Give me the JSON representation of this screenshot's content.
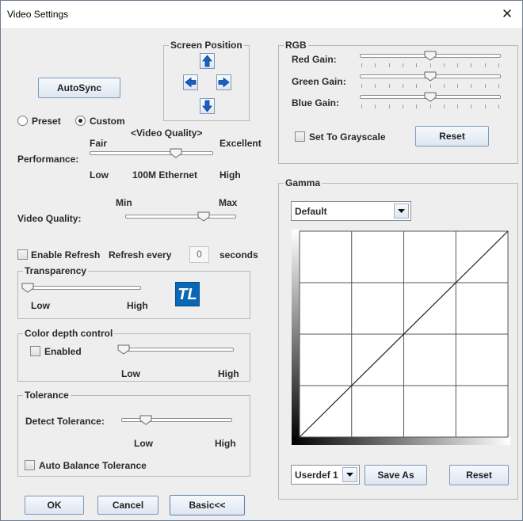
{
  "window": {
    "title": "Video Settings",
    "close_glyph": "✕"
  },
  "autosync_label": "AutoSync",
  "screen_position": {
    "legend": "Screen Position",
    "arrow_icons": [
      "arrow-up-icon",
      "arrow-left-icon",
      "arrow-right-icon",
      "arrow-down-icon"
    ]
  },
  "mode": {
    "preset_label": "Preset",
    "custom_label": "Custom",
    "selected": "Custom"
  },
  "video_quality_header": "<Video Quality>",
  "performance": {
    "label": "Performance:",
    "fair": "Fair",
    "excellent": "Excellent",
    "low": "Low",
    "mid": "100M Ethernet",
    "high": "High",
    "level": 0.72
  },
  "video_quality": {
    "label": "Video Quality:",
    "min": "Min",
    "max": "Max",
    "level": 0.73
  },
  "refresh": {
    "enable_label": "Enable Refresh",
    "every_label": "Refresh every",
    "value": "0",
    "unit": "seconds",
    "enabled": false
  },
  "transparency": {
    "legend": "Transparency",
    "low": "Low",
    "high": "High",
    "level": 0.0,
    "logo_text": "TL"
  },
  "color_depth": {
    "legend": "Color depth control",
    "enabled_label": "Enabled",
    "low": "Low",
    "high": "High",
    "level": 0.0,
    "enabled": false
  },
  "tolerance": {
    "legend": "Tolerance",
    "detect_label": "Detect Tolerance:",
    "low": "Low",
    "high": "High",
    "auto_balance_label": "Auto Balance Tolerance",
    "level": 0.2,
    "auto_balance": false
  },
  "rgb": {
    "legend": "RGB",
    "red_label": "Red Gain:",
    "green_label": "Green Gain:",
    "blue_label": "Blue Gain:",
    "red_level": 0.5,
    "green_level": 0.5,
    "blue_level": 0.5,
    "grayscale_label": "Set To Grayscale",
    "grayscale": false,
    "reset_label": "Reset"
  },
  "gamma": {
    "legend": "Gamma",
    "preset_value": "Default",
    "profile_value": "Userdef 1",
    "save_as_label": "Save As",
    "reset_label": "Reset"
  },
  "footer": {
    "ok_label": "OK",
    "cancel_label": "Cancel",
    "basic_label": "Basic<<"
  },
  "colors": {
    "accent_blue": "#0a67b3",
    "window_bg": "#eeeeee",
    "group_border": "#b8b8b8"
  }
}
